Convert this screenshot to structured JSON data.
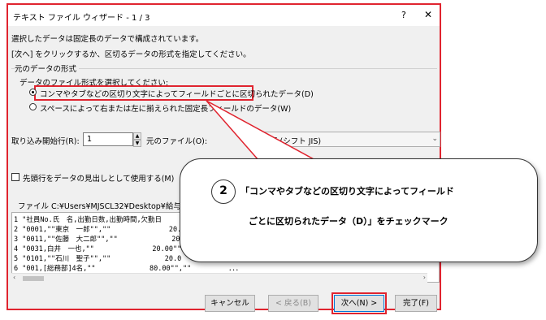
{
  "dialog": {
    "title": "テキスト ファイル ウィザード - 1 / 3",
    "help_label": "?",
    "close_label": "✕",
    "info_line1": "選択したデータは固定長のデータで構成されています。",
    "info_line2": "[次へ] をクリックするか、区切るデータの形式を指定してください。",
    "group_label": "元のデータの形式",
    "format_prompt": "データのファイル形式を選択してください:",
    "radio_delimited": "コンマやタブなどの区切り文字によってフィールドごとに区切られたデータ(D)",
    "radio_fixed": "スペースによって右または左に揃えられた固定長フィールドのデータ(W)",
    "start_row_label": "取り込み開始行(R):",
    "start_row_value": "1",
    "origin_label": "元のファイル(O):",
    "origin_value": "日本語 (シフト JIS)",
    "header_checkbox_label": "先頭行をデータの見出しとして使用する(M)",
    "file_path_label": "ファイル C:¥Users¥MJSCL32¥Desktop¥給与集計表",
    "preview_lines": [
      "1 \"社員No.氏　名,出勤日数,出勤時間,欠勤日",
      "2 \"0001,\"\"東京　一郎\"\",\"\"              20.0",
      "3 \"0011,\"\"佐藤　大二郎\"\",\"\"             20",
      "4 \"0031,白井　一也,\"\"              20.00\"\"",
      "5 \"0101,\"\"石川　聖子\"\",\"\"             20.0",
      "6 \"001,[総務部]4名,\"\"             80.00\"\",\"\"         ．．．"
    ],
    "buttons": {
      "cancel": "キャンセル",
      "back": "< 戻る(B)",
      "next": "次へ(N) >",
      "finish": "完了(F)"
    }
  },
  "callout": {
    "step_number": "2",
    "line1": "「コンマやタブなどの区切り文字によってフィールド",
    "line2": "ごとに区切られたデータ（D）」をチェックマーク"
  },
  "colors": {
    "highlight": "#e0242f",
    "dialog_bg": "#f0f0f0"
  }
}
